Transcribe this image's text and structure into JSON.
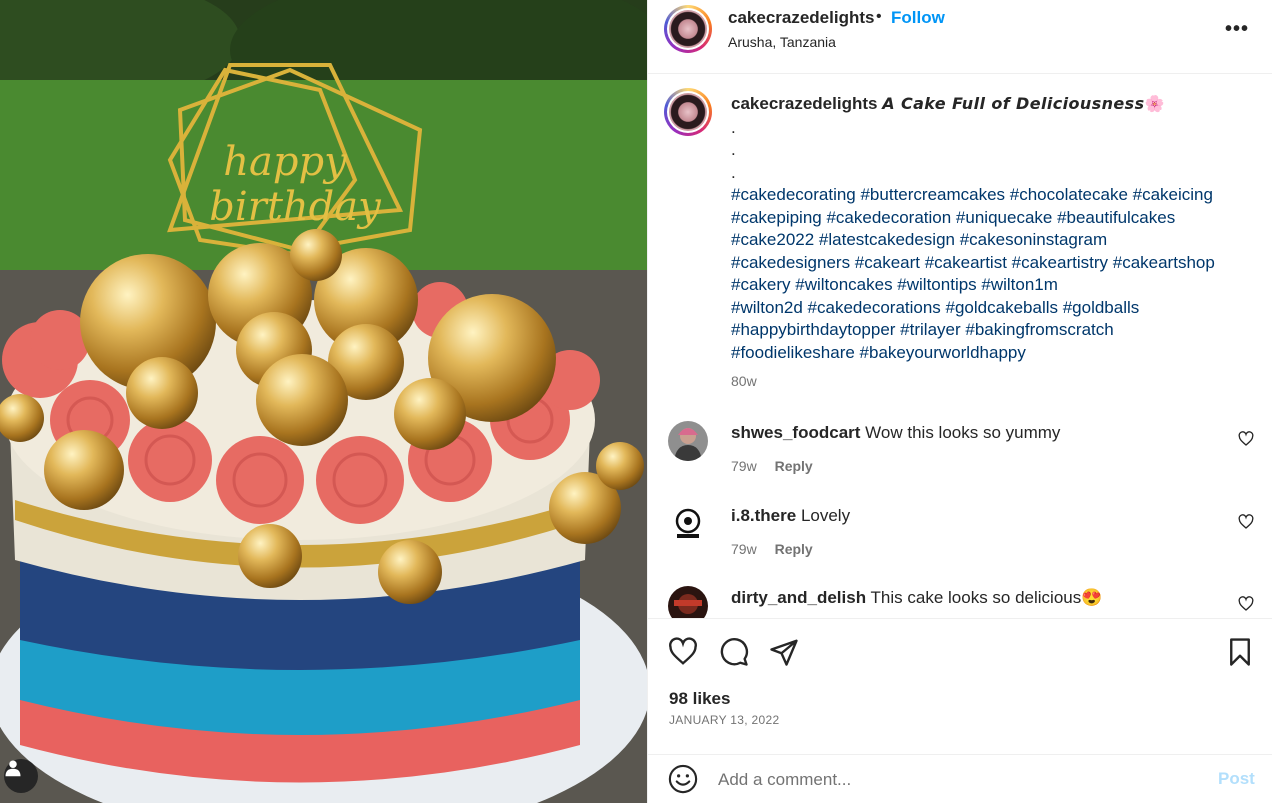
{
  "post": {
    "photo_alt": "",
    "username": "cakecrazedelights",
    "separator": "•",
    "follow_label": "Follow",
    "location": "Arusha, Tanzania",
    "more_label": "•••"
  },
  "caption": {
    "username": "cakecrazedelights",
    "title": "A Cake Full of Deliciousness",
    "emoji": "🌸",
    "dots": [
      ".",
      ".",
      "."
    ],
    "hashtag_lines": [
      "#cakedecorating #buttercreamcakes #chocolatecake #cakeicing",
      "#cakepiping #cakedecoration #uniquecake #beautifulcakes",
      "#cake2022 #latestcakedesign #cakesoninstagram",
      "#cakedesigners #cakeart #cakeartist #cakeartistry #cakeartshop",
      "#cakery #wiltoncakes #wiltontips #wilton1m",
      "#wilton2d #cakedecorations #goldcakeballs #goldballs",
      "#happybirthdaytopper #trilayer #bakingfromscratch",
      "#foodielikeshare #bakeyourworldhappy"
    ],
    "time": "80w"
  },
  "comments": [
    {
      "username": "shwes_foodcart",
      "text": "Wow this looks so yummy",
      "time": "79w",
      "reply": "Reply"
    },
    {
      "username": "i.8.there",
      "text": "Lovely",
      "time": "79w",
      "reply": "Reply"
    },
    {
      "username": "dirty_and_delish",
      "text": "This cake looks so delicious😍",
      "time": "",
      "reply": ""
    }
  ],
  "footer": {
    "likes": "98 likes",
    "date": "JANUARY 13, 2022",
    "comment_placeholder": "Add a comment...",
    "post_label": "Post"
  },
  "colors": {
    "follow": "#0095f6",
    "hashtag": "#00376b",
    "muted": "#737373",
    "post_disabled": "#b2dffc"
  },
  "icons": {
    "like": "heart-icon",
    "comment": "comment-bubble-icon",
    "share": "paper-plane-icon",
    "save": "bookmark-icon",
    "emoji": "smiley-icon",
    "user_tag": "person-icon",
    "more": "more-options-icon"
  }
}
